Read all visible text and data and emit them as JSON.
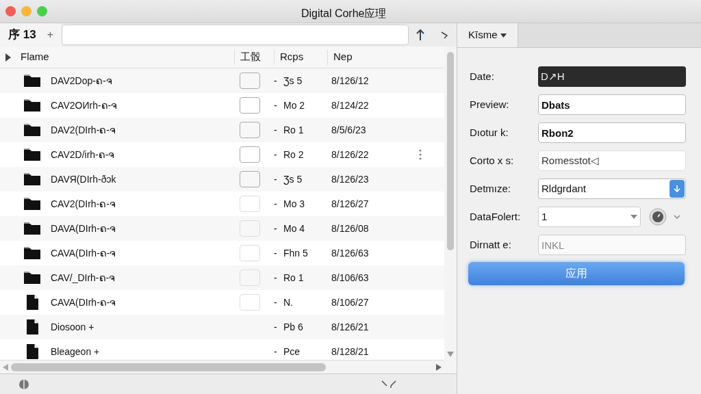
{
  "window": {
    "title": "Digital Corhe应理"
  },
  "tab": {
    "label": "序 13",
    "add": "+"
  },
  "table": {
    "columns": [
      "Flame",
      "工骰",
      "Rcps",
      "Nep"
    ],
    "rows": [
      {
        "kind": "folder",
        "name": "DAV2Dоp-ຄ-ຈ",
        "thumb": true,
        "dash": "-",
        "reps": "Ʒs 5",
        "date": "8/126/12",
        "menu": false
      },
      {
        "kind": "folder",
        "name": "CAV2OИrh-ຄ-ຈ",
        "thumb": true,
        "dash": "-",
        "reps": "Mo 2",
        "date": "8/124/22",
        "menu": false
      },
      {
        "kind": "folder",
        "name": "DAV2(DIrh-ຄ-ຈ",
        "thumb": true,
        "dash": "-",
        "reps": "Ro 1",
        "date": "8/5/6/23",
        "menu": false
      },
      {
        "kind": "folder",
        "name": "CAV2D/irh-ຄ-ຈ",
        "thumb": true,
        "dash": "-",
        "reps": "Ro 2",
        "date": "8/126/22",
        "menu": true
      },
      {
        "kind": "folder",
        "name": "DAVЯ(DIrh-ðɔk",
        "thumb": true,
        "dash": "-",
        "reps": "Ʒs 5",
        "date": "8/126/23",
        "menu": false
      },
      {
        "kind": "folder",
        "name": "CAV2(DIrh-ຄ-ຈ",
        "thumb": true,
        "dash": "-",
        "reps": "Mo 3",
        "date": "8/126/27",
        "menu": false
      },
      {
        "kind": "folder",
        "name": "DAVA(DIrh-ຄ-ຈ",
        "thumb": true,
        "dash": "-",
        "reps": "Mo 4",
        "date": "8/126/08",
        "menu": false
      },
      {
        "kind": "folder",
        "name": "CAVA(DIrh-ຄ-ຈ",
        "thumb": true,
        "dash": "-",
        "reps": "Fhn 5",
        "date": "8/126/63",
        "menu": false
      },
      {
        "kind": "folder",
        "name": "CAV/_DIrh-ຄ-ຈ",
        "thumb": true,
        "dash": "-",
        "reps": "Ro 1",
        "date": "8/106/63",
        "menu": false
      },
      {
        "kind": "file",
        "name": "CAVA(DIrh-ຄ-ຈ",
        "thumb": true,
        "dash": "-",
        "reps": "N.",
        "date": "8/106/27",
        "menu": false
      },
      {
        "kind": "file",
        "name": "Diosoon +",
        "thumb": false,
        "dash": "-",
        "reps": "Pb 6",
        "date": "8/126/21",
        "menu": false
      },
      {
        "kind": "file",
        "name": "Bleageon +",
        "thumb": false,
        "dash": "-",
        "reps": "Pce",
        "date": "8/128/21",
        "menu": false
      }
    ]
  },
  "panel": {
    "tab": "Kīsme",
    "fields": [
      {
        "kind": "dark",
        "label": "Date:",
        "value": "D↗H"
      },
      {
        "kind": "text",
        "label": "Preview:",
        "value": "Dbats"
      },
      {
        "kind": "text",
        "label": "Dıotur k:",
        "value": "Rbon2"
      },
      {
        "kind": "muted",
        "label": "Corto x s:",
        "value": "Romesstot◁"
      },
      {
        "kind": "select",
        "label": "Detmıze:",
        "value": "Rldgrdant"
      },
      {
        "kind": "combo",
        "label": "DataFolert:",
        "value": "1"
      },
      {
        "kind": "placeholder",
        "label": "Dirnatt e:",
        "placeholder": "INKL"
      }
    ],
    "button": "应用"
  }
}
